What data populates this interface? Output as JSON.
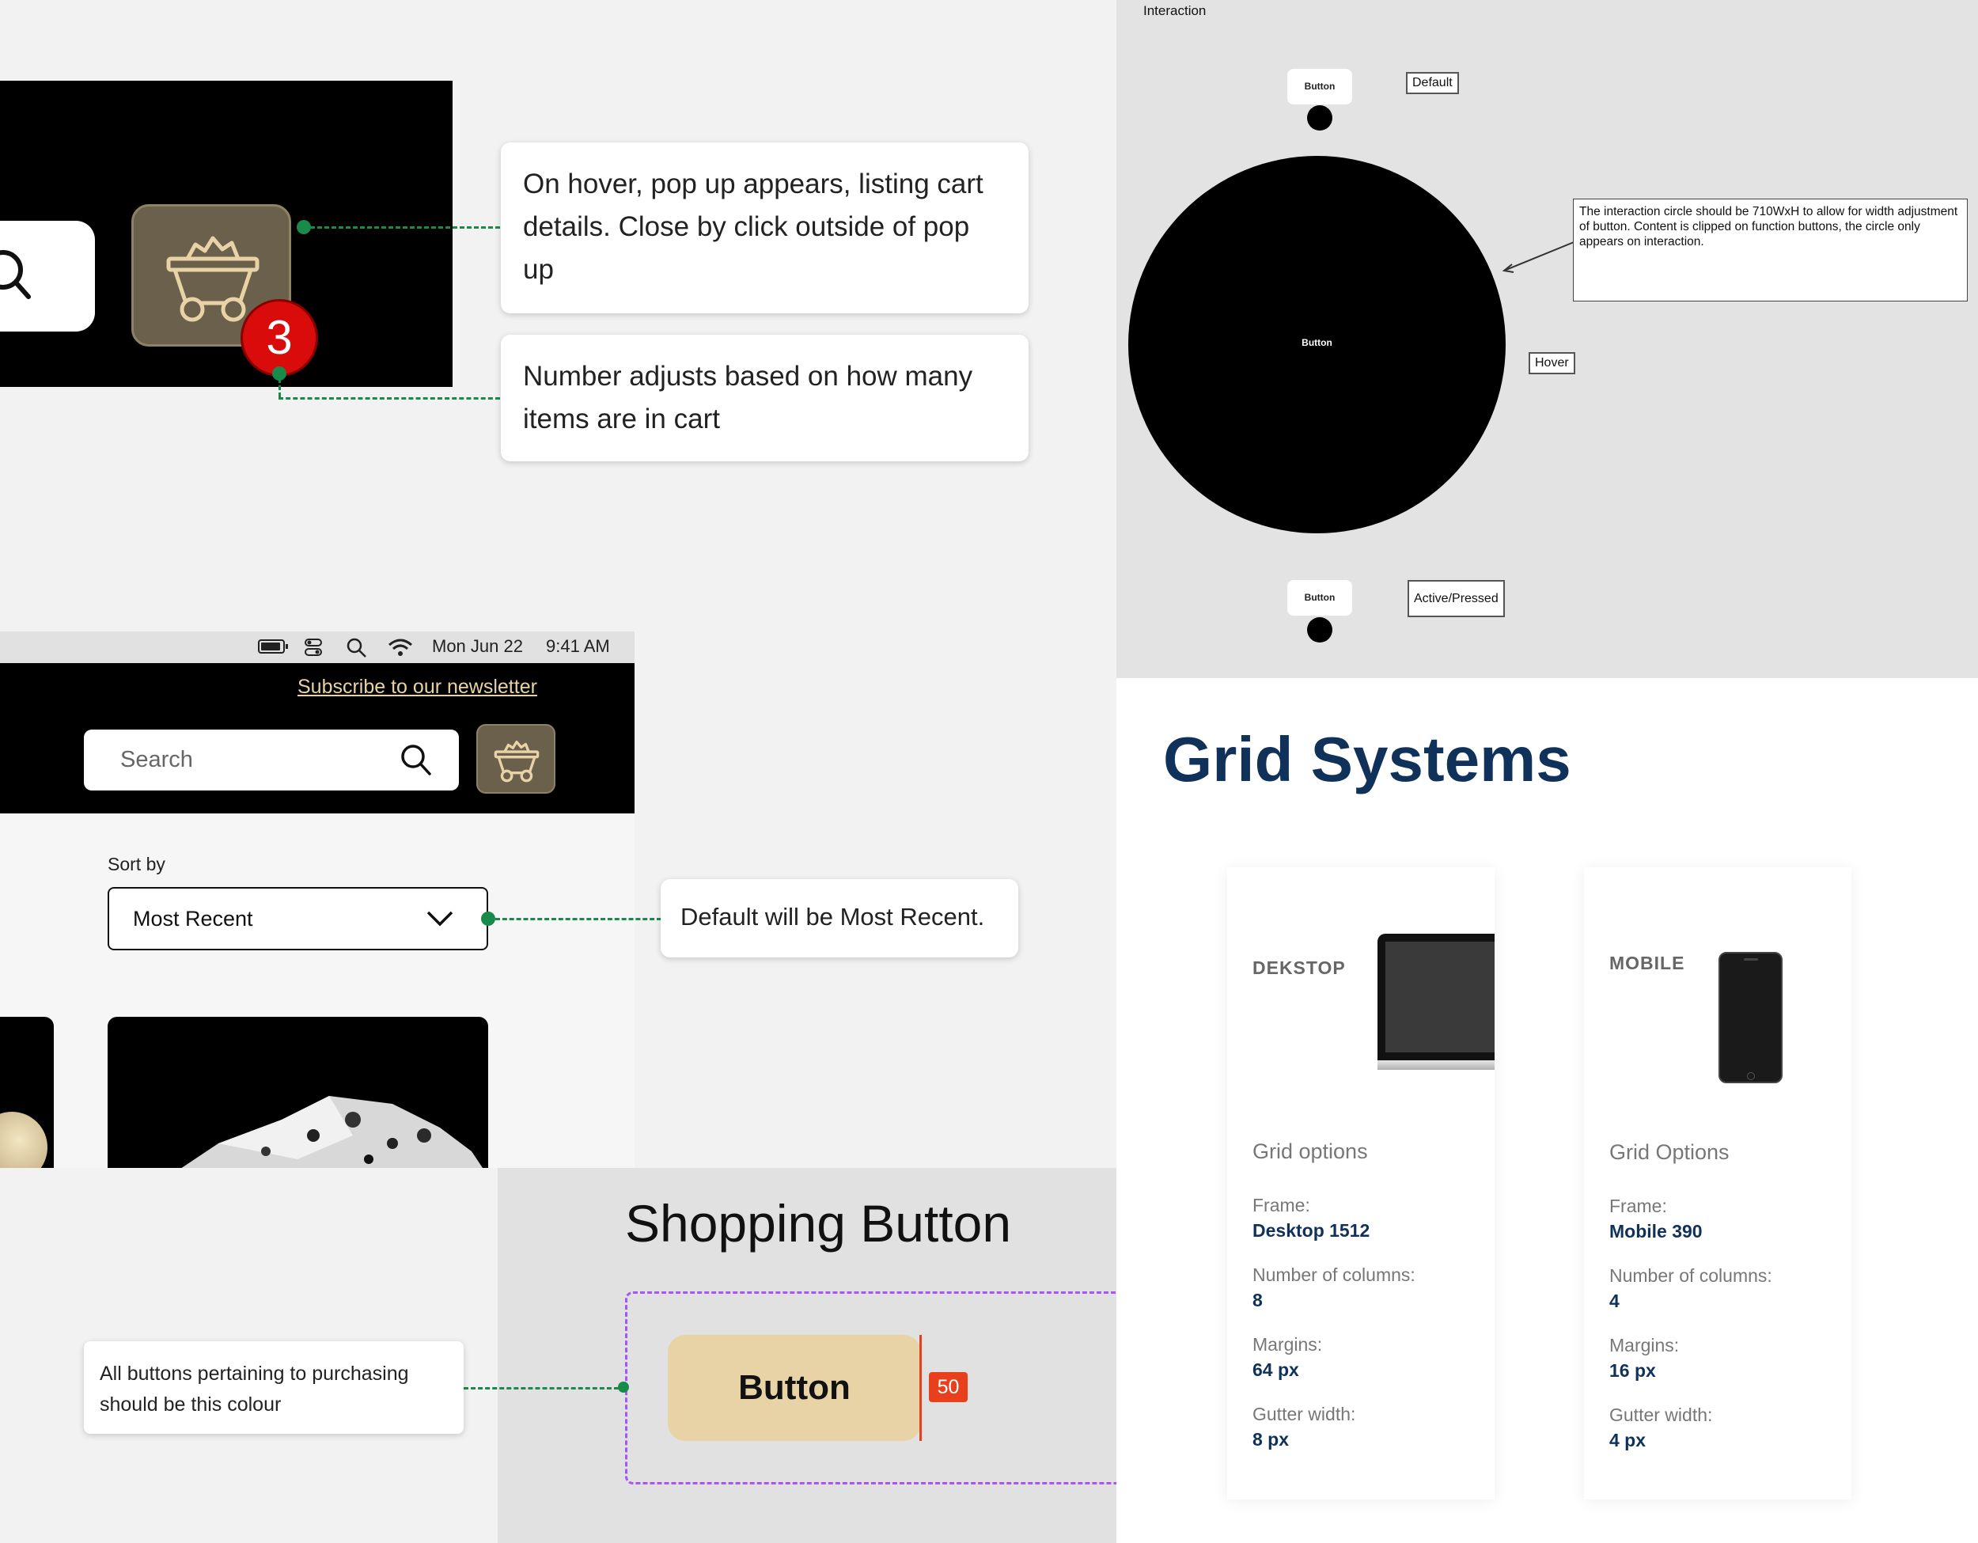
{
  "cart_section": {
    "badge_count": "3",
    "note_hover": "On hover, pop up appears, listing cart details. Close by click outside of pop up",
    "note_number": "Number adjusts based on how many items are in cart"
  },
  "interaction": {
    "title": "Interaction",
    "button_label": "Button",
    "state_default": "Default",
    "state_hover": "Hover",
    "state_active": "Active/Pressed",
    "note": "The interaction circle should be 710WxH to allow for width adjustment of button. Content is clipped on function buttons, the circle only appears on interaction."
  },
  "menu_bar": {
    "date": "Mon Jun 22",
    "time": "9:41 AM"
  },
  "site_header": {
    "newsletter_link": "Subscribe to our newsletter",
    "search_placeholder": "Search"
  },
  "sort": {
    "label": "Sort by",
    "selected": "Most Recent",
    "note": "Default will be Most Recent."
  },
  "grid_systems": {
    "title": "Grid Systems",
    "desktop": {
      "device": "DEKSTOP",
      "heading": "Grid options",
      "frame_label": "Frame:",
      "frame_value": "Desktop 1512",
      "columns_label": "Number of columns:",
      "columns_value": "8",
      "margins_label": "Margins:",
      "margins_value": "64 px",
      "gutter_label": "Gutter width:",
      "gutter_value": "8 px"
    },
    "mobile": {
      "device": "MOBILE",
      "heading": "Grid Options",
      "frame_label": "Frame:",
      "frame_value": "Mobile 390",
      "columns_label": "Number of columns:",
      "columns_value": "4",
      "margins_label": "Margins:",
      "margins_value": "16 px",
      "gutter_label": "Gutter width:",
      "gutter_value": "4 px"
    }
  },
  "shopping_button": {
    "title": "Shopping Button",
    "button_label": "Button",
    "height_badge": "50",
    "note": "All buttons pertaining to purchasing should be this colour"
  },
  "colors": {
    "accent_gold": "#e8d3a7",
    "cart_tile": "#6b604b",
    "badge_red": "#d90b0b",
    "navy": "#10325a",
    "connector_green": "#1a8a4a",
    "frame_purple": "#a855f7",
    "measure_red": "#e8401c"
  }
}
